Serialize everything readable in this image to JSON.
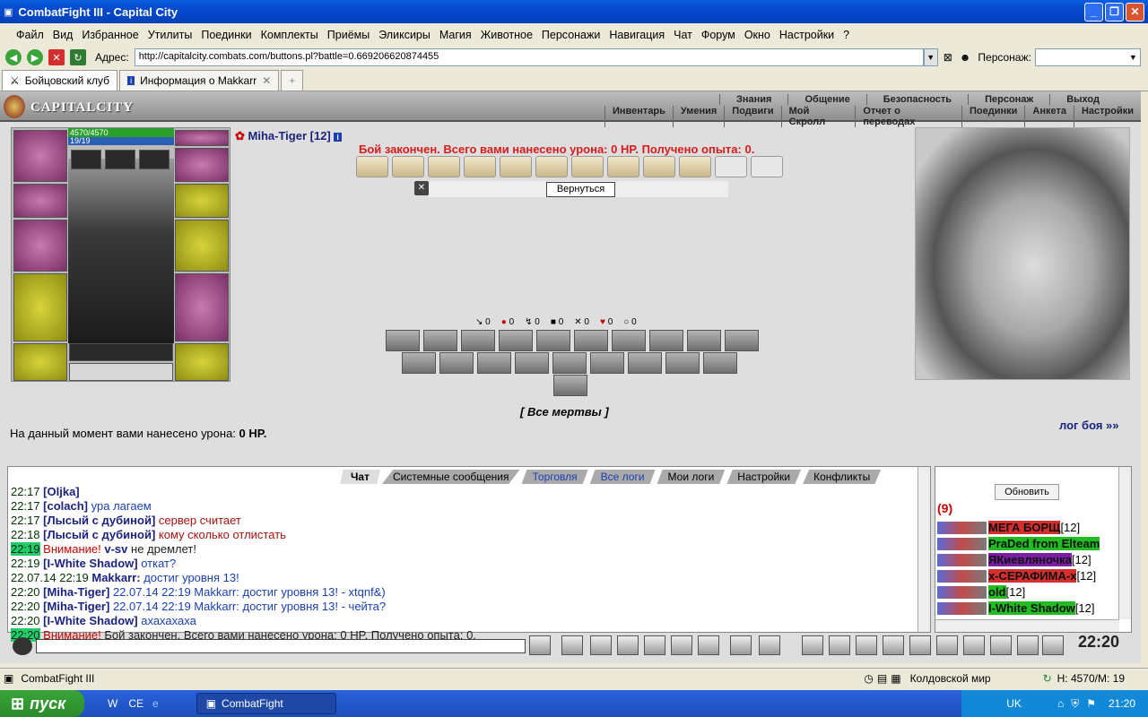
{
  "window": {
    "title": "CombatFight III - Capital City"
  },
  "menu": [
    "Файл",
    "Вид",
    "Избранное",
    "Утилиты",
    "Поединки",
    "Комплекты",
    "Приёмы",
    "Эликсиры",
    "Магия",
    "Животное",
    "Персонажи",
    "Навигация",
    "Чат",
    "Форум",
    "Окно",
    "Настройки",
    "?"
  ],
  "address": {
    "label": "Адрес:",
    "url": "http://capitalcity.combats.com/buttons.pl?battle=0.669206620874455",
    "persona_label": "Персонаж:"
  },
  "tabs": [
    {
      "label": "Бойцовский клуб"
    },
    {
      "label": "Информация о Makkarr"
    }
  ],
  "game": {
    "logo": "CAPITALCITY",
    "top_links": [
      "Знания",
      "Общение",
      "Безопасность",
      "Персонаж",
      "Выход"
    ],
    "sub_links": [
      "Инвентарь",
      "Умения",
      "Подвиги",
      "Мой Скролл",
      "Отчет о переводах",
      "Поединки",
      "Анкета",
      "Настройки"
    ],
    "hp": "4570/4570",
    "mp": "19/19",
    "opponent": "Miha-Tiger [12]",
    "result": "Бой закончен. Всего вами нанесено урона: 0 HP. Получено опыта: 0.",
    "return_label": "Вернуться",
    "stats": [
      "0",
      "0",
      "0",
      "0",
      "0",
      "0",
      "0"
    ],
    "all_dead": "[ Все мертвы ]",
    "damage_now_prefix": "На данный момент вами нанесено урона:",
    "damage_now_value": "0 HP.",
    "battle_log": "лог боя »»"
  },
  "chat": {
    "tabs": [
      "Чат",
      "Системные сообщения",
      "Торговля",
      "Все логи",
      "Мои логи",
      "Настройки",
      "Конфликты"
    ],
    "lines": [
      {
        "time": "22:17",
        "nick": "[Oljka]",
        "text": "",
        "warn": "",
        "highlight": false
      },
      {
        "time": "22:17",
        "nick": "[colach]",
        "text": "ура лагаем",
        "warn": "",
        "highlight": false
      },
      {
        "time": "22:17",
        "nick": "[Лысый с дубиной]",
        "text": "сервер считает",
        "warn": "",
        "highlight": false
      },
      {
        "time": "22:18",
        "nick": "[Лысый с дубиной]",
        "text": "кому сколько отлистать",
        "warn": "",
        "highlight": false
      },
      {
        "time": "22:19",
        "nick": "v-sv",
        "text": "не дремлет!",
        "warn": "Внимание!",
        "highlight": true
      },
      {
        "time": "22:19",
        "nick": "[I-White Shadow]",
        "text": "откат?",
        "warn": "",
        "highlight": false
      },
      {
        "time": "22.07.14 22:19",
        "nick": "Makkarr:",
        "text": "достиг уровня 13!",
        "warn": "",
        "highlight": false
      },
      {
        "time": "22:20",
        "nick": "[Miha-Tiger]",
        "text": "22.07.14 22:19 Makkarr: достиг уровня 13! - xtqnf&)",
        "warn": "",
        "highlight": false
      },
      {
        "time": "22:20",
        "nick": "[Miha-Tiger]",
        "text": "22.07.14 22:19 Makkarr: достиг уровня 13! - чейта?",
        "warn": "",
        "highlight": false
      },
      {
        "time": "22:20",
        "nick": "[I-White Shadow]",
        "text": "ахахахаха",
        "warn": "",
        "highlight": false
      },
      {
        "time": "22:20",
        "nick": "",
        "text": "Бой закончен. Всего вами нанесено урона: 0 HP. Получено опыта: 0.",
        "warn": "Внимание!",
        "highlight": true
      }
    ]
  },
  "online": {
    "refresh_label": "Обновить",
    "count": "(9)",
    "players": [
      {
        "name": "МЕГА БОРЩ",
        "level": "[12]",
        "color": "#d32f2f"
      },
      {
        "name": "PraDed from Elteam",
        "level": "",
        "color": "#22bb22"
      },
      {
        "name": "ЯКиевляночка",
        "level": "[12]",
        "color": "#7b1fa2"
      },
      {
        "name": "x-СЕРАФИМА-x",
        "level": "[12]",
        "color": "#d32f2f"
      },
      {
        "name": "old",
        "level": "[12]",
        "color": "#22bb22"
      },
      {
        "name": "I-White Shadow",
        "level": "[12]",
        "color": "#22bb22"
      }
    ]
  },
  "clock": "22:20",
  "status": {
    "left": "CombatFight III",
    "world": "Колдовской мир",
    "hpmp": "H: 4570/M: 19"
  },
  "taskbar": {
    "start": "пуск",
    "task": "CombatFight",
    "lang": "UK",
    "time": "21:20"
  }
}
